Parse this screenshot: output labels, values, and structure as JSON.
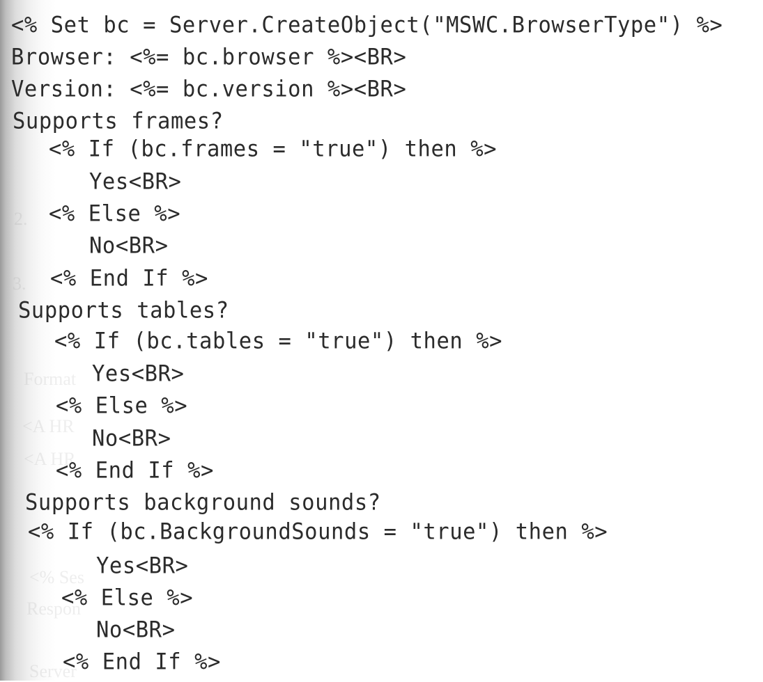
{
  "document": {
    "type": "code-listing",
    "language": "ASP / VBScript",
    "lines": [
      "<% Set bc = Server.CreateObject(\"MSWC.BrowserType\") %>",
      "Browser: <%= bc.browser %><BR>",
      "Version: <%= bc.version %><BR>",
      "Supports frames?",
      "<% If (bc.frames = \"true\") then %>",
      "Yes<BR>",
      "<% Else %>",
      "No<BR>",
      "<% End If %>",
      "Supports tables?",
      "<% If (bc.tables = \"true\") then %>",
      "Yes<BR>",
      "<% Else %>",
      "No<BR>",
      "<% End If %>",
      "Supports background sounds?",
      "<% If (bc.BackgroundSounds = \"true\") then %>",
      "Yes<BR>",
      "<% Else %>",
      "No<BR>",
      "<% End If %>"
    ]
  },
  "bleed_through": [
    "2.",
    "3.",
    "Format",
    "<A HR",
    "<A HR",
    "<% Ses",
    "Respon",
    "Server"
  ]
}
